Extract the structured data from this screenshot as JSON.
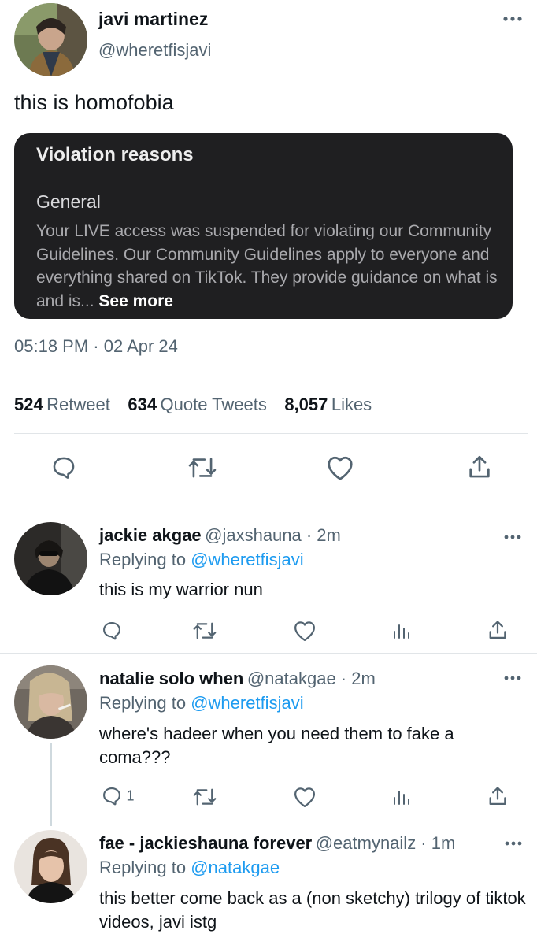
{
  "tweet": {
    "author_name": "javi martinez",
    "author_handle": "@wheretfisjavi",
    "text": "this is homofobia",
    "card": {
      "title": "Violation reasons",
      "subtitle": "General",
      "body": "Your LIVE access was suspended for violating our Community Guidelines. Our Community Guidelines apply to everyone and everything shared on TikTok. They provide guidance on what is and is...",
      "see_more": "See more"
    },
    "timestamp": "05:18 PM · 02 Apr 24",
    "stats": {
      "retweets_count": "524",
      "retweets_label": "Retweet",
      "quotes_count": "634",
      "quotes_label": "Quote Tweets",
      "likes_count": "8,057",
      "likes_label": "Likes"
    },
    "more_icon": "more-dots-icon"
  },
  "replies": [
    {
      "name": "jackie akgae",
      "handle": "@jaxshauna · 2m",
      "replying_prefix": "Replying to",
      "replying_to": "@wheretfisjavi",
      "text": "this is my warrior nun",
      "reply_count": ""
    },
    {
      "name": "natalie solo when",
      "handle": "@natakgae · 2m",
      "replying_prefix": "Replying to",
      "replying_to": "@wheretfisjavi",
      "text": "where's hadeer when you need them to fake a coma???",
      "reply_count": "1"
    },
    {
      "name": "fae - jackieshauna forever",
      "handle": "@eatmynailz · 1m",
      "replying_prefix": "Replying to",
      "replying_to": "@natakgae",
      "text": "this better come back as a (non sketchy) trilogy of tiktok videos, javi istg"
    }
  ],
  "colors": {
    "link": "#1d9bf0",
    "secondary_text": "#536471",
    "card_bg": "#1f1f21"
  }
}
